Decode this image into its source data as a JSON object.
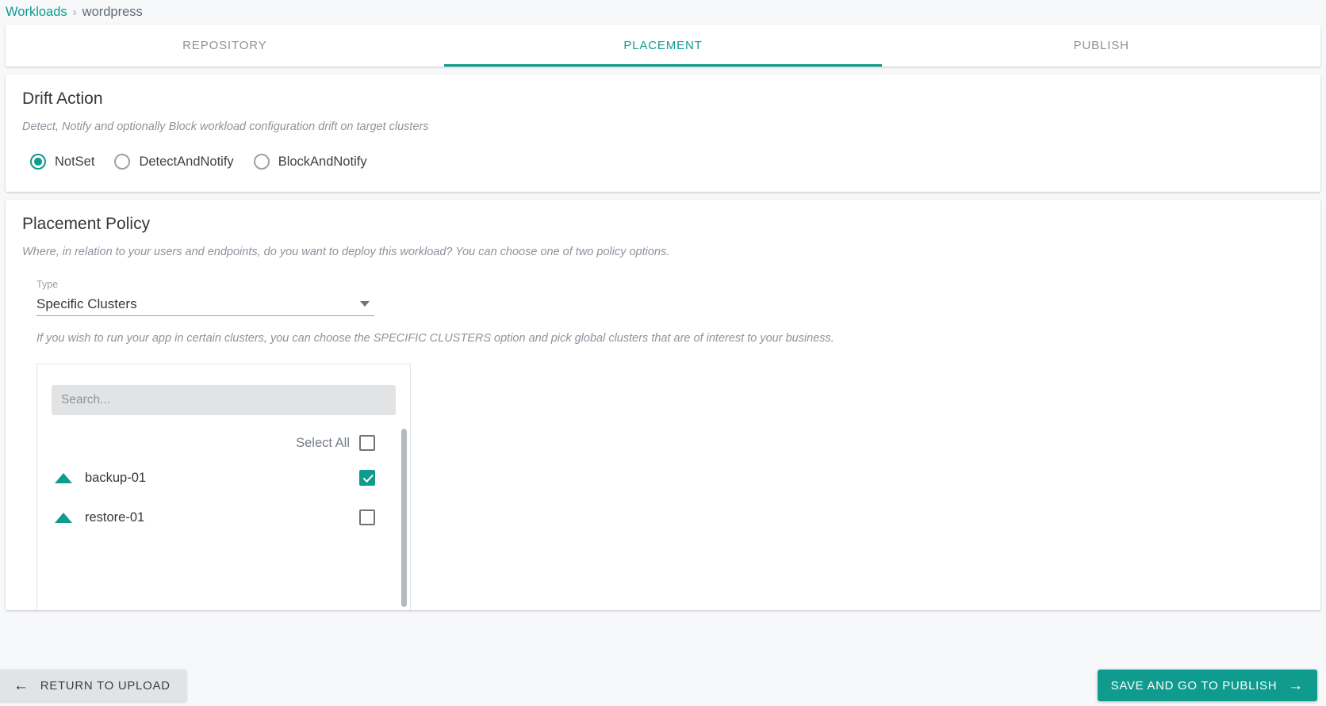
{
  "breadcrumb": {
    "root": "Workloads",
    "separator": "›",
    "current": "wordpress"
  },
  "tabs": [
    {
      "label": "REPOSITORY",
      "active": false
    },
    {
      "label": "PLACEMENT",
      "active": true
    },
    {
      "label": "PUBLISH",
      "active": false
    }
  ],
  "drift_action": {
    "title": "Drift Action",
    "description": "Detect, Notify and optionally Block workload configuration drift on target clusters",
    "options": [
      {
        "label": "NotSet",
        "checked": true
      },
      {
        "label": "DetectAndNotify",
        "checked": false
      },
      {
        "label": "BlockAndNotify",
        "checked": false
      }
    ]
  },
  "placement_policy": {
    "title": "Placement Policy",
    "description": "Where, in relation to your users and endpoints, do you want to deploy this workload? You can choose one of two policy options.",
    "type_field": {
      "label": "Type",
      "value": "Specific Clusters",
      "options": [
        "Specific Clusters"
      ]
    },
    "help_text": "If you wish to run your app in certain clusters, you can choose the SPECIFIC CLUSTERS option and pick global clusters that are of interest to your business.",
    "search": {
      "placeholder": "Search...",
      "value": ""
    },
    "select_all": {
      "label": "Select All",
      "checked": false
    },
    "clusters": [
      {
        "name": "backup-01",
        "checked": true,
        "icon": "cluster-triangle-icon"
      },
      {
        "name": "restore-01",
        "checked": false,
        "icon": "cluster-triangle-icon"
      }
    ]
  },
  "footer": {
    "return_label": "RETURN TO UPLOAD",
    "return_icon": "arrow-left-icon",
    "publish_label": "SAVE AND GO TO PUBLISH",
    "publish_icon": "arrow-right-icon"
  },
  "colors": {
    "accent": "#0f9b8e",
    "page_bg": "#f7f8fa",
    "card_bg": "#ffffff",
    "muted_text": "#8d949c",
    "body_text": "#33383d",
    "search_bg": "#e2e3e4"
  }
}
